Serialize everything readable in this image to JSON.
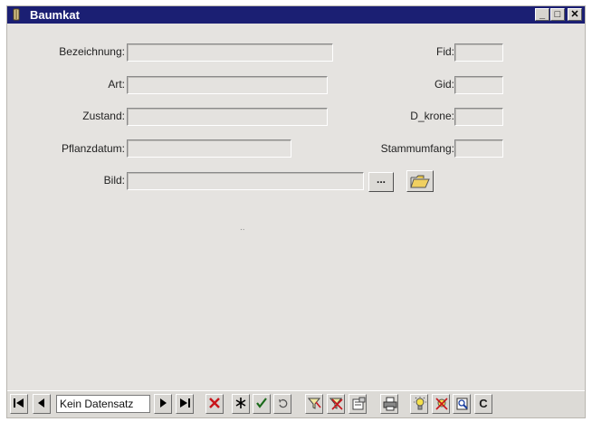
{
  "window": {
    "title": "Baumkat",
    "minimize": "_",
    "maximize": "□",
    "close": "✕"
  },
  "form": {
    "bezeichnung": {
      "label": "Bezeichnung:",
      "value": ""
    },
    "art": {
      "label": "Art:",
      "value": ""
    },
    "zustand": {
      "label": "Zustand:",
      "value": ""
    },
    "pflanzdatum": {
      "label": "Pflanzdatum:",
      "value": ""
    },
    "bild": {
      "label": "Bild:",
      "value": "",
      "browse_label": "..."
    },
    "fid": {
      "label": "Fid:",
      "value": ""
    },
    "gid": {
      "label": "Gid:",
      "value": ""
    },
    "d_krone": {
      "label": "D_krone:",
      "value": ""
    },
    "stammumfang": {
      "label": "Stammumfang:",
      "value": ""
    },
    "dots": ".."
  },
  "navbar": {
    "record_text": "Kein Datensatz",
    "last_label": "C"
  },
  "colors": {
    "titlebar": "#1b1f73",
    "window_bg": "#e5e3e0",
    "delete_red": "#c8151b",
    "confirm_green": "#1a6a1a"
  }
}
